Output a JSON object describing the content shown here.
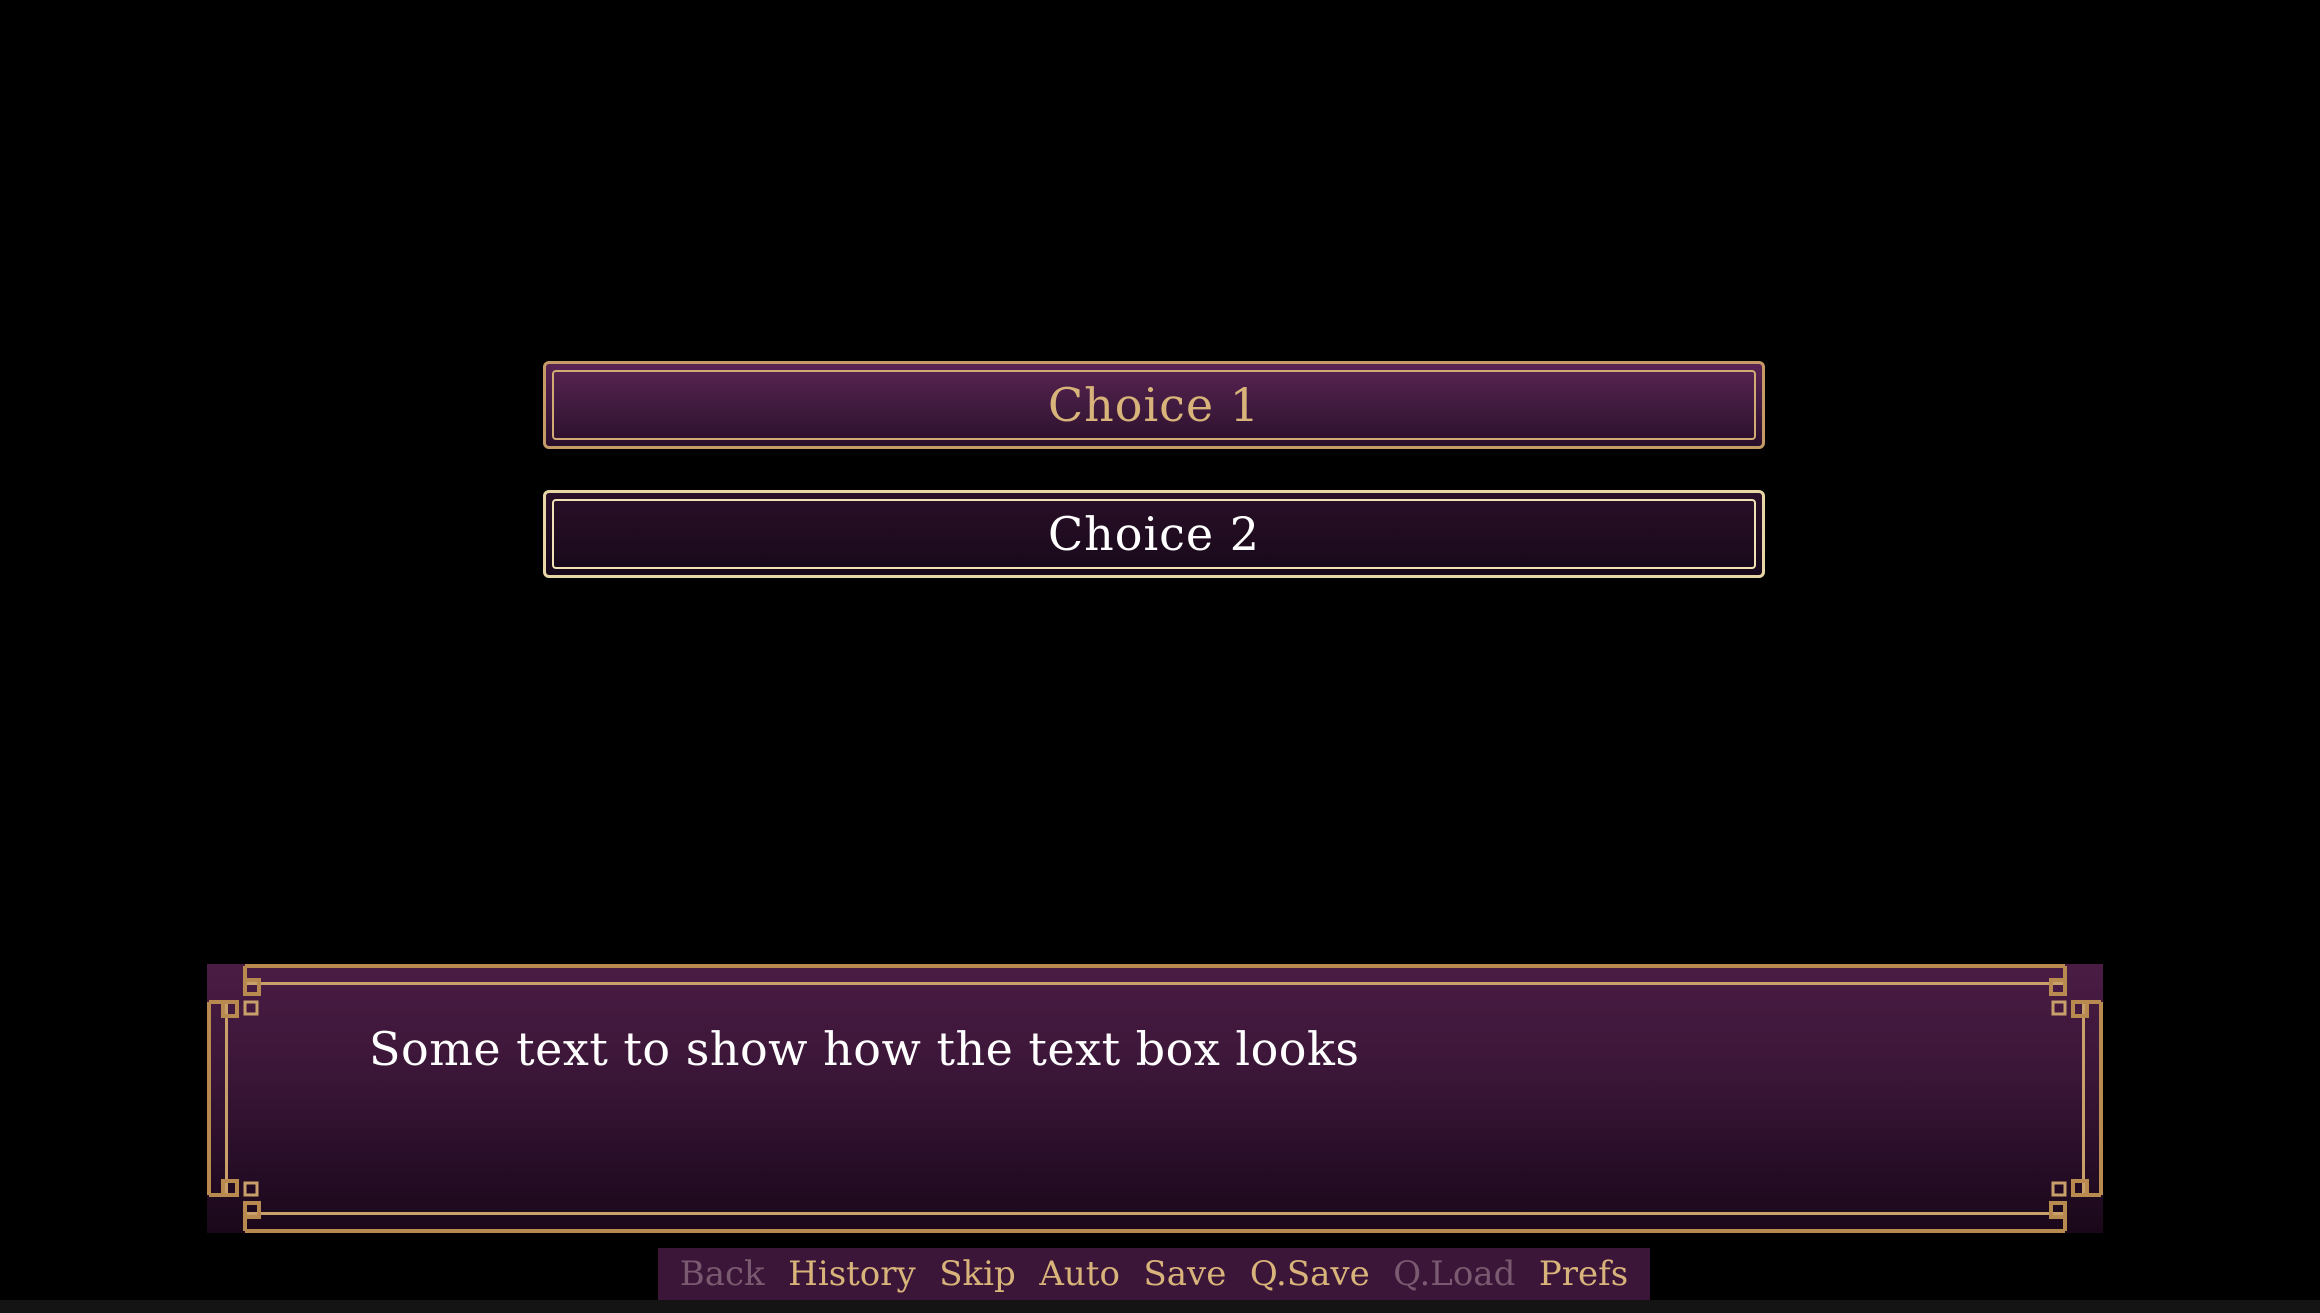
{
  "choices": [
    {
      "label": "Choice 1",
      "state": "hovered"
    },
    {
      "label": "Choice 2",
      "state": "idle"
    }
  ],
  "dialogue": {
    "text": "Some text to show how the text box looks"
  },
  "quick_menu": [
    {
      "label": "Back",
      "enabled": false
    },
    {
      "label": "History",
      "enabled": true
    },
    {
      "label": "Skip",
      "enabled": true
    },
    {
      "label": "Auto",
      "enabled": true
    },
    {
      "label": "Save",
      "enabled": true
    },
    {
      "label": "Q.Save",
      "enabled": true
    },
    {
      "label": "Q.Load",
      "enabled": false
    },
    {
      "label": "Prefs",
      "enabled": true
    }
  ],
  "colors": {
    "background": "#000000",
    "gold": "#d9b47a",
    "frame_gold": "#b98a50",
    "purple": "#3b1638",
    "disabled": "#7a5a70"
  }
}
